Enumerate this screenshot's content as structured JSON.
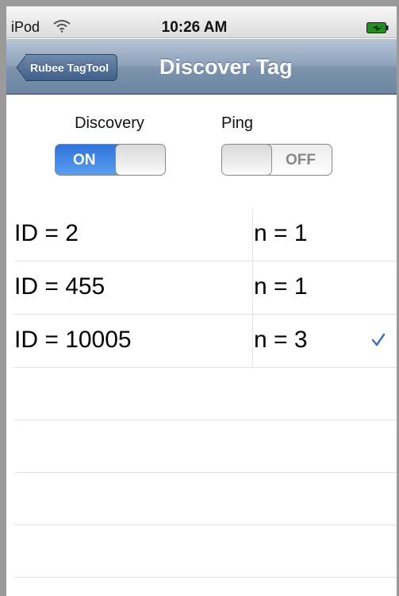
{
  "status": {
    "carrier": "iPod",
    "time": "10:26 AM",
    "wifi_icon": "wifi-icon",
    "battery_icon": "battery-charging-icon"
  },
  "nav": {
    "back_label": "Rubee TagTool",
    "title": "Discover Tag",
    "bar_color": "#8ea2bb"
  },
  "switches": {
    "discovery": {
      "label": "Discovery",
      "state": "ON"
    },
    "ping": {
      "label": "Ping",
      "state": "OFF"
    }
  },
  "tags": [
    {
      "id": "ID = 2",
      "n": "n = 1",
      "checked": false
    },
    {
      "id": "ID = 455",
      "n": "n = 1",
      "checked": false
    },
    {
      "id": "ID = 10005",
      "n": "n = 3",
      "checked": true
    }
  ],
  "checkmark_icon": "checkmark-icon",
  "accent_color": "#3b74c7"
}
